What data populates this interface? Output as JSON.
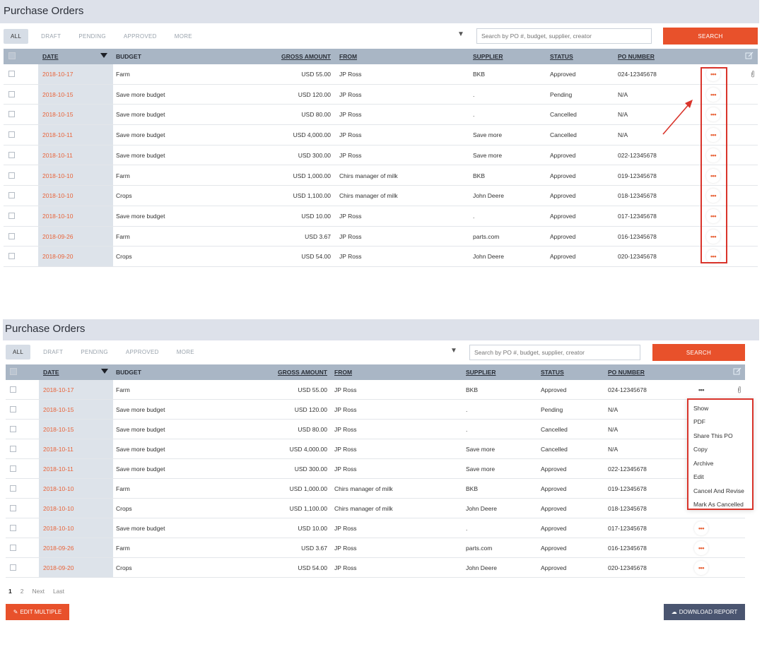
{
  "page_title": "Purchase Orders",
  "tabs": [
    "ALL",
    "DRAFT",
    "PENDING",
    "APPROVED",
    "MORE"
  ],
  "search": {
    "placeholder": "Search by PO #, budget, supplier, creator",
    "button_label": "SEARCH"
  },
  "columns": {
    "date": "DATE",
    "budget": "BUDGET",
    "gross_amount": "GROSS AMOUNT",
    "from": "FROM",
    "supplier": "SUPPLIER",
    "status": "STATUS",
    "po_number": "PO NUMBER"
  },
  "rows": [
    {
      "date": "2018-10-17",
      "budget": "Farm",
      "amount": "USD 55.00",
      "from": "JP Ross",
      "supplier": "BKB",
      "status": "Approved",
      "po": "024-12345678"
    },
    {
      "date": "2018-10-15",
      "budget": "Save more budget",
      "amount": "USD 120.00",
      "from": "JP Ross",
      "supplier": ".",
      "status": "Pending",
      "po": "N/A"
    },
    {
      "date": "2018-10-15",
      "budget": "Save more budget",
      "amount": "USD 80.00",
      "from": "JP Ross",
      "supplier": ".",
      "status": "Cancelled",
      "po": "N/A"
    },
    {
      "date": "2018-10-11",
      "budget": "Save more budget",
      "amount": "USD 4,000.00",
      "from": "JP Ross",
      "supplier": "Save more",
      "status": "Cancelled",
      "po": "N/A"
    },
    {
      "date": "2018-10-11",
      "budget": "Save more budget",
      "amount": "USD 300.00",
      "from": "JP Ross",
      "supplier": "Save more",
      "status": "Approved",
      "po": "022-12345678"
    },
    {
      "date": "2018-10-10",
      "budget": "Farm",
      "amount": "USD 1,000.00",
      "from": "Chirs manager of milk",
      "supplier": "BKB",
      "status": "Approved",
      "po": "019-12345678"
    },
    {
      "date": "2018-10-10",
      "budget": "Crops",
      "amount": "USD 1,100.00",
      "from": "Chirs manager of milk",
      "supplier": "John Deere",
      "status": "Approved",
      "po": "018-12345678"
    },
    {
      "date": "2018-10-10",
      "budget": "Save more budget",
      "amount": "USD 10.00",
      "from": "JP Ross",
      "supplier": ".",
      "status": "Approved",
      "po": "017-12345678"
    },
    {
      "date": "2018-09-26",
      "budget": "Farm",
      "amount": "USD 3.67",
      "from": "JP Ross",
      "supplier": "parts.com",
      "status": "Approved",
      "po": "016-12345678"
    },
    {
      "date": "2018-09-20",
      "budget": "Crops",
      "amount": "USD 54.00",
      "from": "JP Ross",
      "supplier": "John Deere",
      "status": "Approved",
      "po": "020-12345678"
    }
  ],
  "row_menu": [
    "Show",
    "PDF",
    "Share This PO",
    "Copy",
    "Archive",
    "Edit",
    "Cancel And Revise",
    "Mark As Cancelled"
  ],
  "pagination": {
    "pages": [
      "1",
      "2"
    ],
    "next": "Next",
    "last": "Last"
  },
  "buttons": {
    "edit_multiple": "EDIT MULTIPLE",
    "download_report": "DOWNLOAD REPORT"
  },
  "icons": {
    "dots": "•••",
    "filter": "filter-icon",
    "edit": "edit-icon",
    "attachment": "paperclip-icon",
    "cloud": "cloud-download-icon"
  },
  "colors": {
    "accent": "#e8512b",
    "date_link": "#e8643a",
    "header_bg": "#a9b6c5",
    "highlight": "#d9342b"
  }
}
